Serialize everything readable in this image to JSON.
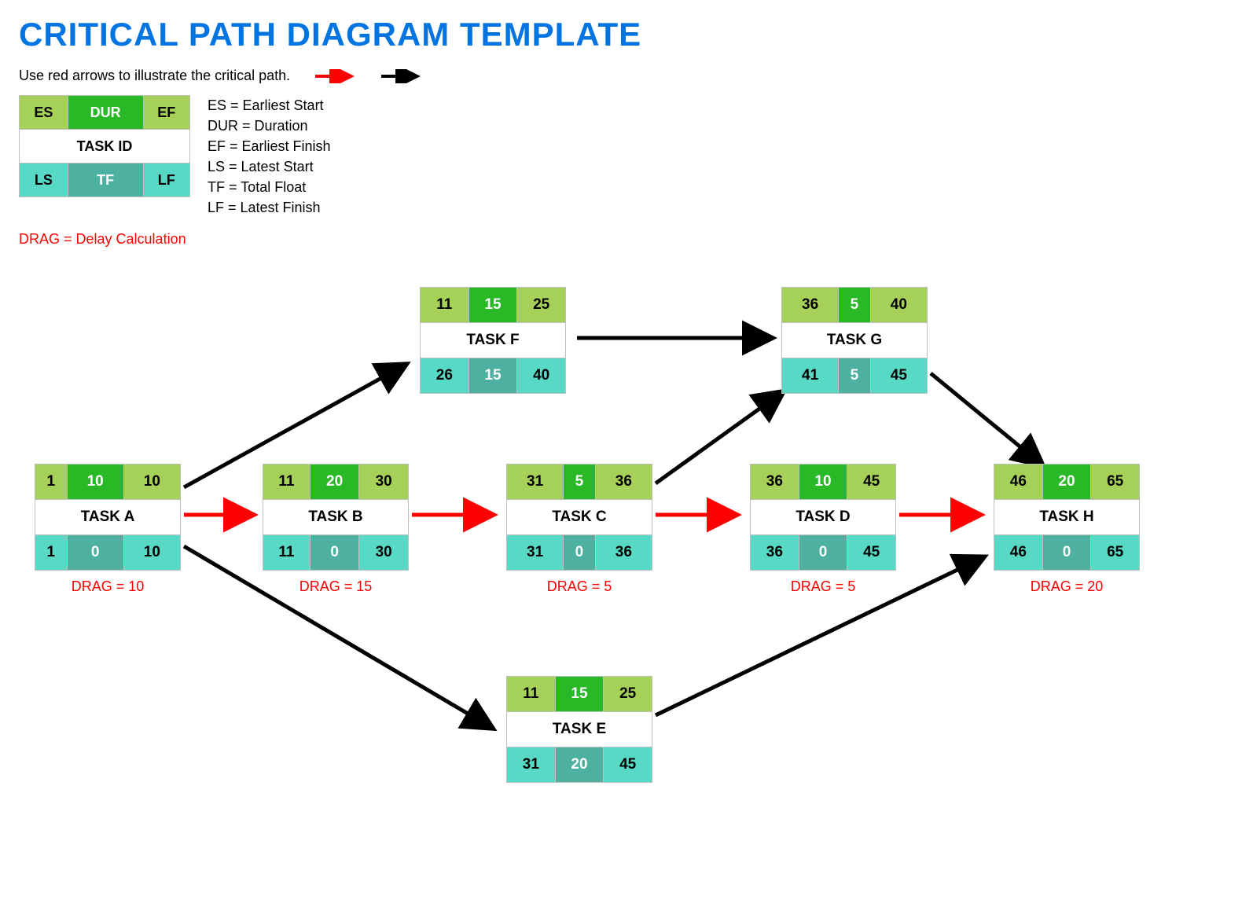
{
  "title": "CRITICAL PATH DIAGRAM TEMPLATE",
  "instruction": "Use red arrows to illustrate the critical path.",
  "legend": {
    "es": "ES",
    "dur": "DUR",
    "ef": "EF",
    "task": "TASK ID",
    "ls": "LS",
    "tf": "TF",
    "lf": "LF",
    "defs": {
      "es": "ES = Earliest Start",
      "dur": "DUR = Duration",
      "ef": "EF = Earliest Finish",
      "ls": "LS = Latest Start",
      "tf": "TF = Total Float",
      "lf": "LF = Latest Finish"
    },
    "drag": "DRAG = Delay Calculation"
  },
  "nodes": {
    "A": {
      "name": "TASK A",
      "es": "1",
      "dur": "10",
      "ef": "10",
      "ls": "1",
      "tf": "0",
      "lf": "10",
      "drag": "DRAG = 10"
    },
    "B": {
      "name": "TASK B",
      "es": "11",
      "dur": "20",
      "ef": "30",
      "ls": "11",
      "tf": "0",
      "lf": "30",
      "drag": "DRAG = 15"
    },
    "C": {
      "name": "TASK C",
      "es": "31",
      "dur": "5",
      "ef": "36",
      "ls": "31",
      "tf": "0",
      "lf": "36",
      "drag": "DRAG = 5"
    },
    "D": {
      "name": "TASK D",
      "es": "36",
      "dur": "10",
      "ef": "45",
      "ls": "36",
      "tf": "0",
      "lf": "45",
      "drag": "DRAG = 5"
    },
    "E": {
      "name": "TASK E",
      "es": "11",
      "dur": "15",
      "ef": "25",
      "ls": "31",
      "tf": "20",
      "lf": "45",
      "drag": ""
    },
    "F": {
      "name": "TASK F",
      "es": "11",
      "dur": "15",
      "ef": "25",
      "ls": "26",
      "tf": "15",
      "lf": "40",
      "drag": ""
    },
    "G": {
      "name": "TASK G",
      "es": "36",
      "dur": "5",
      "ef": "40",
      "ls": "41",
      "tf": "5",
      "lf": "45",
      "drag": ""
    },
    "H": {
      "name": "TASK H",
      "es": "46",
      "dur": "20",
      "ef": "65",
      "ls": "46",
      "tf": "0",
      "lf": "65",
      "drag": "DRAG = 20"
    }
  },
  "colors": {
    "critical": "#ff0000",
    "normal": "#000000"
  }
}
